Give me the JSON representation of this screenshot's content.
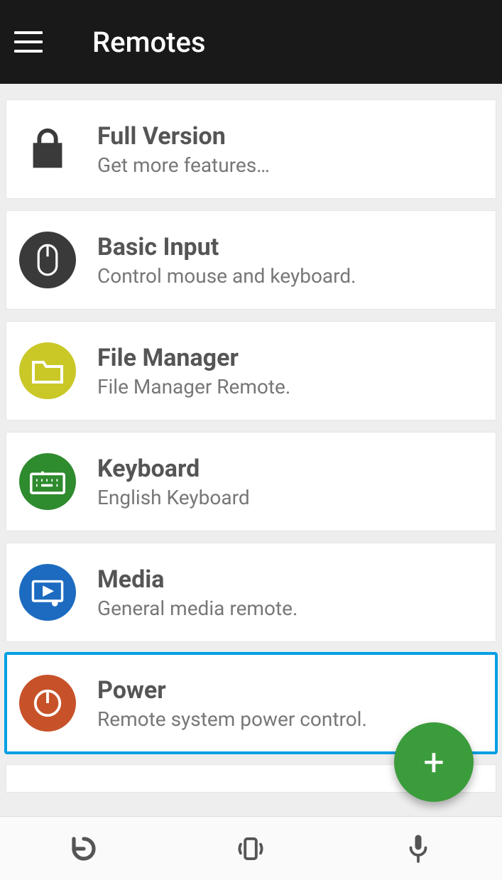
{
  "header": {
    "title": "Remotes"
  },
  "items": [
    {
      "title": "Full Version",
      "subtitle": "Get more features…",
      "icon": "lock-icon",
      "bg": "transparent",
      "fg": "#3a3a3a"
    },
    {
      "title": "Basic Input",
      "subtitle": "Control mouse and keyboard.",
      "icon": "mouse-icon",
      "bg": "#3a3a3a",
      "fg": "#ffffff"
    },
    {
      "title": "File Manager",
      "subtitle": "File Manager Remote.",
      "icon": "folder-icon",
      "bg": "#c9c827",
      "fg": "#ffffff"
    },
    {
      "title": "Keyboard",
      "subtitle": "English Keyboard",
      "icon": "keyboard-icon",
      "bg": "#2e8b2e",
      "fg": "#ffffff"
    },
    {
      "title": "Media",
      "subtitle": "General media remote.",
      "icon": "media-icon",
      "bg": "#1c6bc0",
      "fg": "#ffffff"
    },
    {
      "title": "Power",
      "subtitle": "Remote system power control.",
      "icon": "power-icon",
      "bg": "#c7522a",
      "fg": "#ffffff",
      "selected": true
    }
  ],
  "fab": {
    "label": "+"
  },
  "bottombar": {
    "refresh": "refresh",
    "vibrate": "vibrate",
    "mic": "mic"
  }
}
